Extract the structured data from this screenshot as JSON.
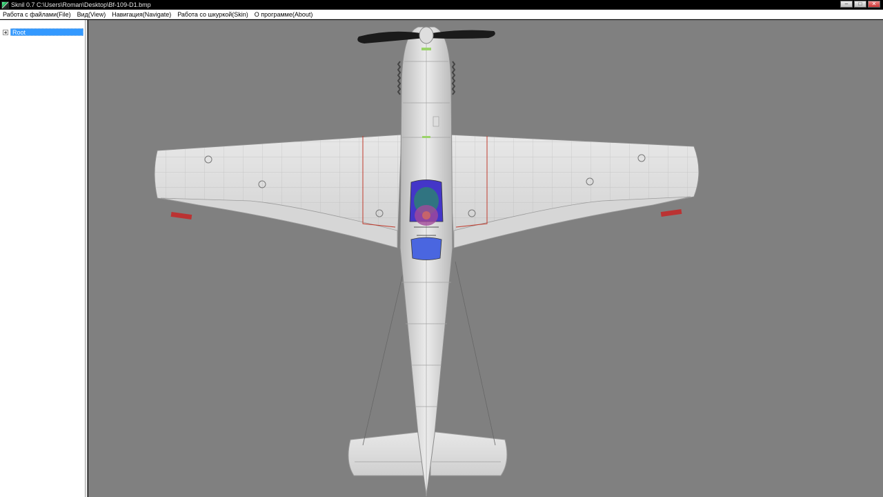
{
  "window": {
    "title": "Sknil 0.7   C:\\Users\\Roman\\Desktop\\Bf-109-D1.bmp",
    "controls": {
      "minimize": "–",
      "maximize": "□",
      "close": "✕"
    }
  },
  "menu": {
    "items": [
      {
        "label": "Работа с файлами(File)"
      },
      {
        "label": "Вид(View)"
      },
      {
        "label": "Навигация(Navigate)"
      },
      {
        "label": "Работа со шкуркой(Skin)"
      },
      {
        "label": "О программе(About)"
      }
    ]
  },
  "tree": {
    "root_label": "Root"
  },
  "viewport": {
    "background": "#808080",
    "model": "aircraft-top-view"
  },
  "colors": {
    "selection": "#3399ff",
    "airframe": "#dcdcdc",
    "panel_lines": "#9a9a9a",
    "trim_red": "#c0392b",
    "canopy_blue": "#3b5bd6",
    "propeller": "#1a1a1a"
  }
}
